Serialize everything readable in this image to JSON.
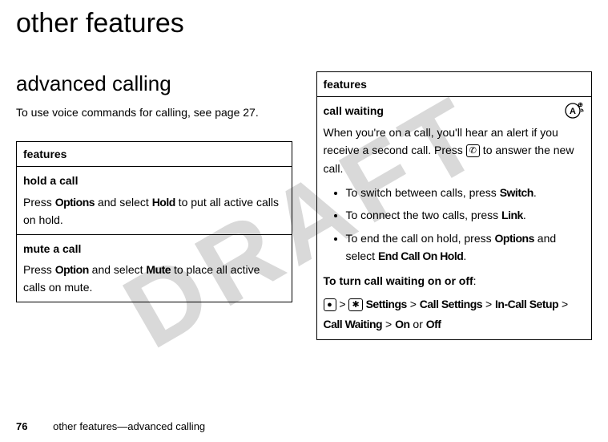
{
  "watermark": "DRAFT",
  "page_title": "other features",
  "left": {
    "heading": "advanced calling",
    "intro": "To use voice commands for calling, see page 27.",
    "table_header": "features",
    "rows": [
      {
        "title": "hold a call",
        "text_before": "Press ",
        "kw1": "Options",
        "text_mid": " and select ",
        "kw2": "Hold",
        "text_after": " to put all active calls on hold."
      },
      {
        "title": "mute a call",
        "text_before": "Press ",
        "kw1": "Option",
        "text_mid": " and select ",
        "kw2": "Mute",
        "text_after": " to place all active calls on mute."
      }
    ]
  },
  "right": {
    "table_header": "features",
    "cw_title": "call waiting",
    "cw_desc_before": "When you're on a call, you'll hear an alert if you receive a second call. Press ",
    "cw_key_glyph": "✆",
    "cw_desc_after": " to answer the new call.",
    "bullets": [
      {
        "before": "To switch between calls, press ",
        "kw": "Switch",
        "after": "."
      },
      {
        "before": "To connect the two calls, press ",
        "kw": "Link",
        "after": "."
      },
      {
        "before": "To end the call on hold, press ",
        "kw": "Options",
        "mid": " and select ",
        "kw2": "End Call On Hold",
        "after": "."
      }
    ],
    "toggle_label": "To turn call waiting on or off",
    "path": {
      "dot": "●",
      "gt": ">",
      "gear": "✱",
      "p1": "Settings",
      "p2": "Call Settings",
      "p3": "In-Call Setup",
      "p4": "Call Waiting",
      "on": "On",
      "or": " or ",
      "off": "Off"
    }
  },
  "footer": {
    "page_number": "76",
    "section": "other features—advanced calling"
  }
}
